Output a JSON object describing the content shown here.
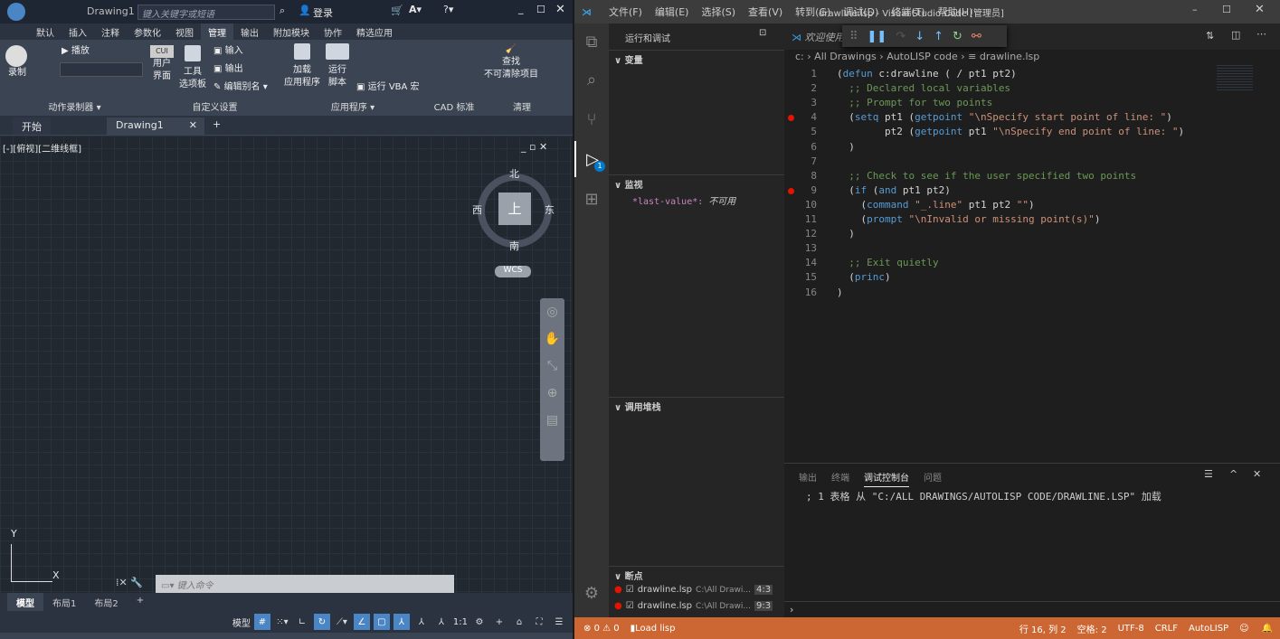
{
  "autocad": {
    "title": {
      "doc": "Drawing1",
      "search_placeholder": "键入关键字或短语",
      "login": "登录"
    },
    "ribbon_tabs": [
      "默认",
      "插入",
      "注释",
      "参数化",
      "视图",
      "管理",
      "输出",
      "附加模块",
      "协作",
      "精选应用"
    ],
    "active_ribbon_tab": "管理",
    "ribbon": {
      "record": "录制",
      "play": "播放",
      "action_recorder": "动作录制器",
      "cui_user": "用户",
      "cui_iface": "界面",
      "cui_badge": "CUI",
      "tool": "工具",
      "palette": "选项板",
      "import": "输入",
      "export": "输出",
      "edit_alias": "编辑别名",
      "customize": "自定义设置",
      "load_app1": "加载",
      "load_app2": "应用程序",
      "run_script1": "运行",
      "run_script2": "脚本",
      "run_vba": "运行 VBA 宏",
      "applications": "应用程序",
      "cad_standards": "CAD 标准",
      "find1": "查找",
      "find2": "不可清除项目",
      "purge": "清理"
    },
    "doc_tabs": [
      "开始",
      "Drawing1"
    ],
    "viewport_label": "[-][俯视][二维线框]",
    "viewcube": {
      "north": "北",
      "south": "南",
      "east": "东",
      "west": "西",
      "top": "上",
      "wcs": "WCS"
    },
    "ucs": {
      "x": "X",
      "y": "Y"
    },
    "command_placeholder": "键入命令",
    "layout_tabs": [
      "模型",
      "布局1",
      "布局2"
    ],
    "status": {
      "model": "模型",
      "scale": "1:1"
    }
  },
  "vscode": {
    "menu": [
      "文件(F)",
      "编辑(E)",
      "选择(S)",
      "查看(V)",
      "转到(G)",
      "调试(D)",
      "终端(T)",
      "帮助(H)"
    ],
    "window_title": "drawline.lsp - Visual Studio Code [管理员]",
    "sidebar_title": "运行和调试",
    "sections": {
      "variables": "变量",
      "watch": "监视",
      "callstack": "调用堆栈",
      "breakpoints": "断点"
    },
    "watch_item": {
      "name": "*last-value*:",
      "value": "不可用"
    },
    "breakpoints": [
      {
        "file": "drawline.lsp",
        "path": "C:\\All Drawi...",
        "pos": "4:3"
      },
      {
        "file": "drawline.lsp",
        "path": "C:\\All Drawi...",
        "pos": "9:3"
      }
    ],
    "editor_tab": "欢迎使用",
    "breadcrumbs": [
      "c:",
      "All Drawings",
      "AutoLISP code",
      "drawline.lsp"
    ],
    "debug_badge": "1",
    "breakpoint_lines": [
      4,
      9
    ],
    "code": [
      [
        [
          "p",
          "("
        ],
        [
          "kw",
          "defun"
        ],
        [
          "p",
          " c:drawline ( / pt1 pt2)"
        ]
      ],
      [
        [
          "p",
          "  "
        ],
        [
          "cm",
          ";; Declared local variables"
        ]
      ],
      [
        [
          "p",
          "  "
        ],
        [
          "cm",
          ";; Prompt for two points"
        ]
      ],
      [
        [
          "p",
          "  ("
        ],
        [
          "kw",
          "setq"
        ],
        [
          "p",
          " pt1 ("
        ],
        [
          "kw",
          "getpoint"
        ],
        [
          "p",
          " "
        ],
        [
          "st",
          "\"\\nSpecify start point of line: \""
        ],
        [
          "p",
          ")"
        ]
      ],
      [
        [
          "p",
          "        pt2 ("
        ],
        [
          "kw",
          "getpoint"
        ],
        [
          "p",
          " pt1 "
        ],
        [
          "st",
          "\"\\nSpecify end point of line: \""
        ],
        [
          "p",
          ")"
        ]
      ],
      [
        [
          "p",
          "  )"
        ]
      ],
      [
        [
          "p",
          ""
        ]
      ],
      [
        [
          "p",
          "  "
        ],
        [
          "cm",
          ";; Check to see if the user specified two points"
        ]
      ],
      [
        [
          "p",
          "  ("
        ],
        [
          "kw",
          "if"
        ],
        [
          "p",
          " ("
        ],
        [
          "kw",
          "and"
        ],
        [
          "p",
          " pt1 pt2)"
        ]
      ],
      [
        [
          "p",
          "    ("
        ],
        [
          "kw",
          "command"
        ],
        [
          "p",
          " "
        ],
        [
          "st",
          "\"_.line\""
        ],
        [
          "p",
          " pt1 pt2 "
        ],
        [
          "st",
          "\"\""
        ],
        [
          "p",
          ")"
        ]
      ],
      [
        [
          "p",
          "    ("
        ],
        [
          "kw",
          "prompt"
        ],
        [
          "p",
          " "
        ],
        [
          "st",
          "\"\\nInvalid or missing point(s)\""
        ],
        [
          "p",
          ")"
        ]
      ],
      [
        [
          "p",
          "  )"
        ]
      ],
      [
        [
          "p",
          ""
        ]
      ],
      [
        [
          "p",
          "  "
        ],
        [
          "cm",
          ";; Exit quietly"
        ]
      ],
      [
        [
          "p",
          "  ("
        ],
        [
          "kw",
          "princ"
        ],
        [
          "p",
          ")"
        ]
      ],
      [
        [
          "p",
          ")"
        ]
      ]
    ],
    "panel_tabs": [
      "输出",
      "终端",
      "调试控制台",
      "问题"
    ],
    "active_panel_tab": "调试控制台",
    "console_output": "; 1 表格 从 \"C:/ALL DRAWINGS/AUTOLISP CODE/DRAWLINE.LSP\" 加载",
    "console_prompt": "›",
    "status": {
      "errors": "0",
      "warnings": "0",
      "load_lisp": "Load lisp",
      "position": "行 16, 列 2",
      "spaces": "空格: 2",
      "encoding": "UTF-8",
      "eol": "CRLF",
      "language": "AutoLISP"
    },
    "colors": {
      "statusbar": "#cc6633",
      "keyword": "#569cd6",
      "comment": "#6a9955",
      "string": "#ce9178",
      "breakpoint": "#e51400"
    }
  }
}
